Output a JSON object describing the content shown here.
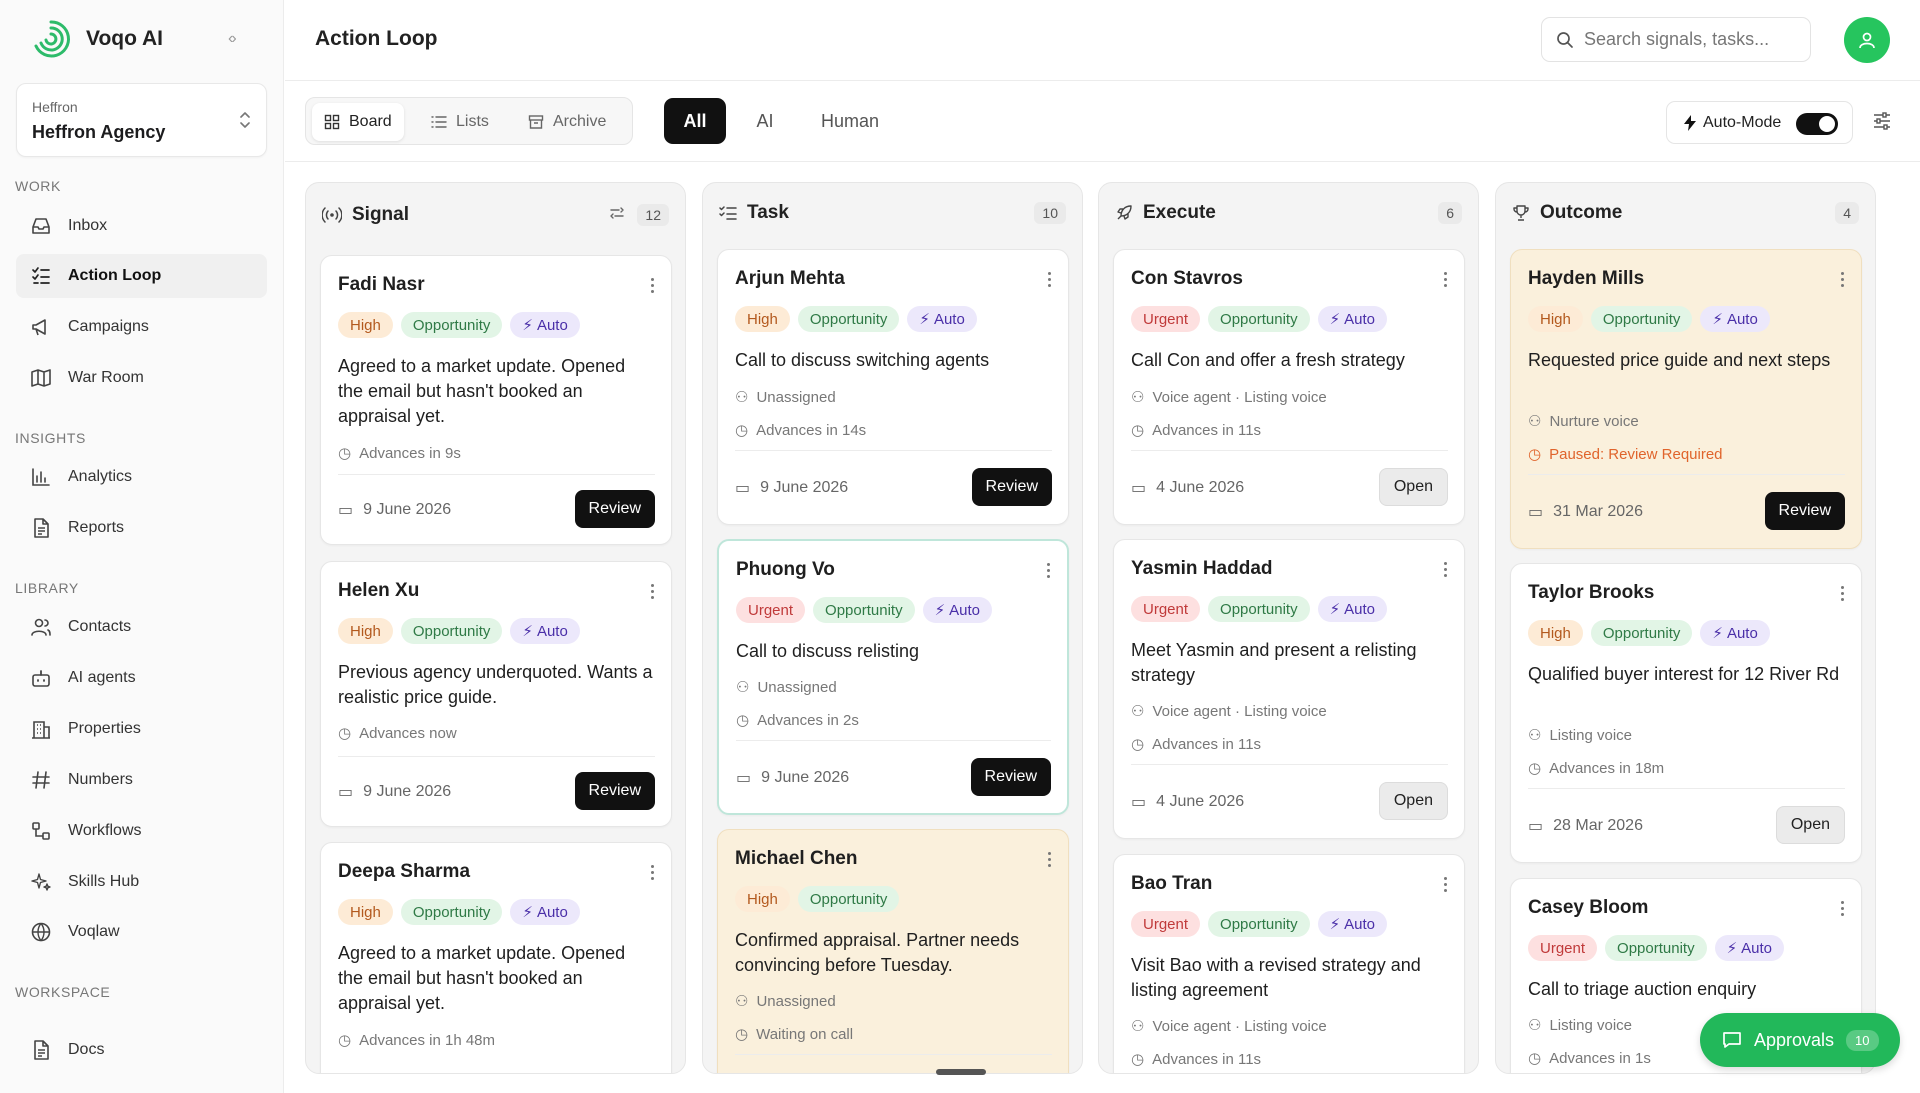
{
  "app": {
    "name": "Voqo AI"
  },
  "agency": {
    "label": "Heffron",
    "name": "Heffron Agency"
  },
  "sidebar": {
    "sections": [
      {
        "title": "WORK",
        "items": [
          {
            "label": "Inbox"
          },
          {
            "label": "Action Loop",
            "active": true
          },
          {
            "label": "Campaigns"
          },
          {
            "label": "War Room"
          }
        ]
      },
      {
        "title": "INSIGHTS",
        "items": [
          {
            "label": "Analytics"
          },
          {
            "label": "Reports"
          }
        ]
      },
      {
        "title": "LIBRARY",
        "items": [
          {
            "label": "Contacts"
          },
          {
            "label": "AI agents"
          },
          {
            "label": "Properties"
          },
          {
            "label": "Numbers"
          },
          {
            "label": "Workflows"
          },
          {
            "label": "Skills Hub"
          },
          {
            "label": "Voqlaw"
          }
        ]
      },
      {
        "title": "WORKSPACE",
        "items": [
          {
            "label": "Docs"
          }
        ]
      }
    ]
  },
  "header": {
    "title": "Action Loop",
    "search_placeholder": "Search signals, tasks..."
  },
  "toolbar": {
    "views": [
      {
        "label": "Board",
        "active": true
      },
      {
        "label": "Lists"
      },
      {
        "label": "Archive"
      }
    ],
    "filters": [
      {
        "label": "All",
        "active": true
      },
      {
        "label": "AI"
      },
      {
        "label": "Human"
      }
    ],
    "automode_label": "Auto-Mode",
    "automode_on": true
  },
  "columns": [
    {
      "title": "Signal",
      "count": "12",
      "icon": "signal-icon",
      "cards": [
        {
          "name": "Fadi Nasr",
          "tags": [
            "High",
            "Opportunity",
            "Auto"
          ],
          "desc": "Agreed to a market update. Opened the email but hasn't booked an appraisal yet.",
          "meta": [
            "Advances in 9s"
          ],
          "date": "9 June 2026",
          "action": "Review"
        },
        {
          "name": "Helen Xu",
          "tags": [
            "High",
            "Opportunity",
            "Auto"
          ],
          "desc": "Previous agency underquoted. Wants a realistic price guide.",
          "meta": [
            "Advances now"
          ],
          "date": "9 June 2026",
          "action": "Review"
        },
        {
          "name": "Deepa Sharma",
          "tags": [
            "High",
            "Opportunity",
            "Auto"
          ],
          "desc": "Agreed to a market update. Opened the email but hasn't booked an appraisal yet.",
          "meta": [
            "Advances in 1h 48m"
          ]
        }
      ]
    },
    {
      "title": "Task",
      "count": "10",
      "icon": "task-list-icon",
      "cards": [
        {
          "name": "Arjun Mehta",
          "tags": [
            "High",
            "Opportunity",
            "Auto"
          ],
          "desc": "Call to discuss switching agents",
          "meta": [
            "Unassigned",
            "Advances in 14s"
          ],
          "date": "9 June 2026",
          "action": "Review"
        },
        {
          "name": "Phuong Vo",
          "tags": [
            "Urgent",
            "Opportunity",
            "Auto"
          ],
          "desc": "Call to discuss relisting",
          "meta": [
            "Unassigned",
            "Advances in 2s"
          ],
          "date": "9 June 2026",
          "action": "Review"
        },
        {
          "name": "Michael Chen",
          "tags": [
            "High",
            "Opportunity"
          ],
          "desc": "Confirmed appraisal. Partner needs convincing before Tuesday.",
          "meta": [
            "Unassigned",
            "Waiting on call"
          ]
        }
      ]
    },
    {
      "title": "Execute",
      "count": "6",
      "icon": "rocket-icon",
      "cards": [
        {
          "name": "Con Stavros",
          "tags": [
            "Urgent",
            "Opportunity",
            "Auto"
          ],
          "desc": "Call Con and offer a fresh strategy",
          "meta": [
            "Voice agent · Listing voice",
            "Advances in 11s"
          ],
          "date": "4 June 2026",
          "action": "Open"
        },
        {
          "name": "Yasmin Haddad",
          "tags": [
            "Urgent",
            "Opportunity",
            "Auto"
          ],
          "desc": "Meet Yasmin and present a relisting strategy",
          "meta": [
            "Voice agent · Listing voice",
            "Advances in 11s"
          ],
          "date": "4 June 2026",
          "action": "Open"
        },
        {
          "name": "Bao Tran",
          "tags": [
            "Urgent",
            "Opportunity",
            "Auto"
          ],
          "desc": "Visit Bao with a revised strategy and listing agreement",
          "meta": [
            "Voice agent · Listing voice",
            "Advances in 11s"
          ]
        }
      ]
    },
    {
      "title": "Outcome",
      "count": "4",
      "icon": "trophy-icon",
      "cards": [
        {
          "name": "Hayden Mills",
          "tags": [
            "High",
            "Opportunity",
            "Auto"
          ],
          "desc": "Requested price guide and next steps",
          "meta": [
            "Nurture voice",
            "Paused: Review Required"
          ],
          "date": "31 Mar 2026",
          "action": "Review"
        },
        {
          "name": "Taylor Brooks",
          "tags": [
            "High",
            "Opportunity",
            "Auto"
          ],
          "desc": "Qualified buyer interest for 12 River Rd",
          "meta": [
            "Listing voice",
            "Advances in 18m"
          ],
          "date": "28 Mar 2026",
          "action": "Open"
        },
        {
          "name": "Casey Bloom",
          "tags": [
            "Urgent",
            "Opportunity",
            "Auto"
          ],
          "desc": "Call to triage auction enquiry",
          "meta": [
            "Listing voice",
            "Advances in 1s"
          ]
        }
      ]
    }
  ],
  "approvals": {
    "label": "Approvals",
    "count": "10"
  },
  "colors": {
    "brand_green": "#22b85a",
    "high": "#b3591e",
    "urgent": "#c03a3a",
    "opportunity": "#2f7a46",
    "auto": "#4a2fa8",
    "paused": "#e0642c"
  }
}
